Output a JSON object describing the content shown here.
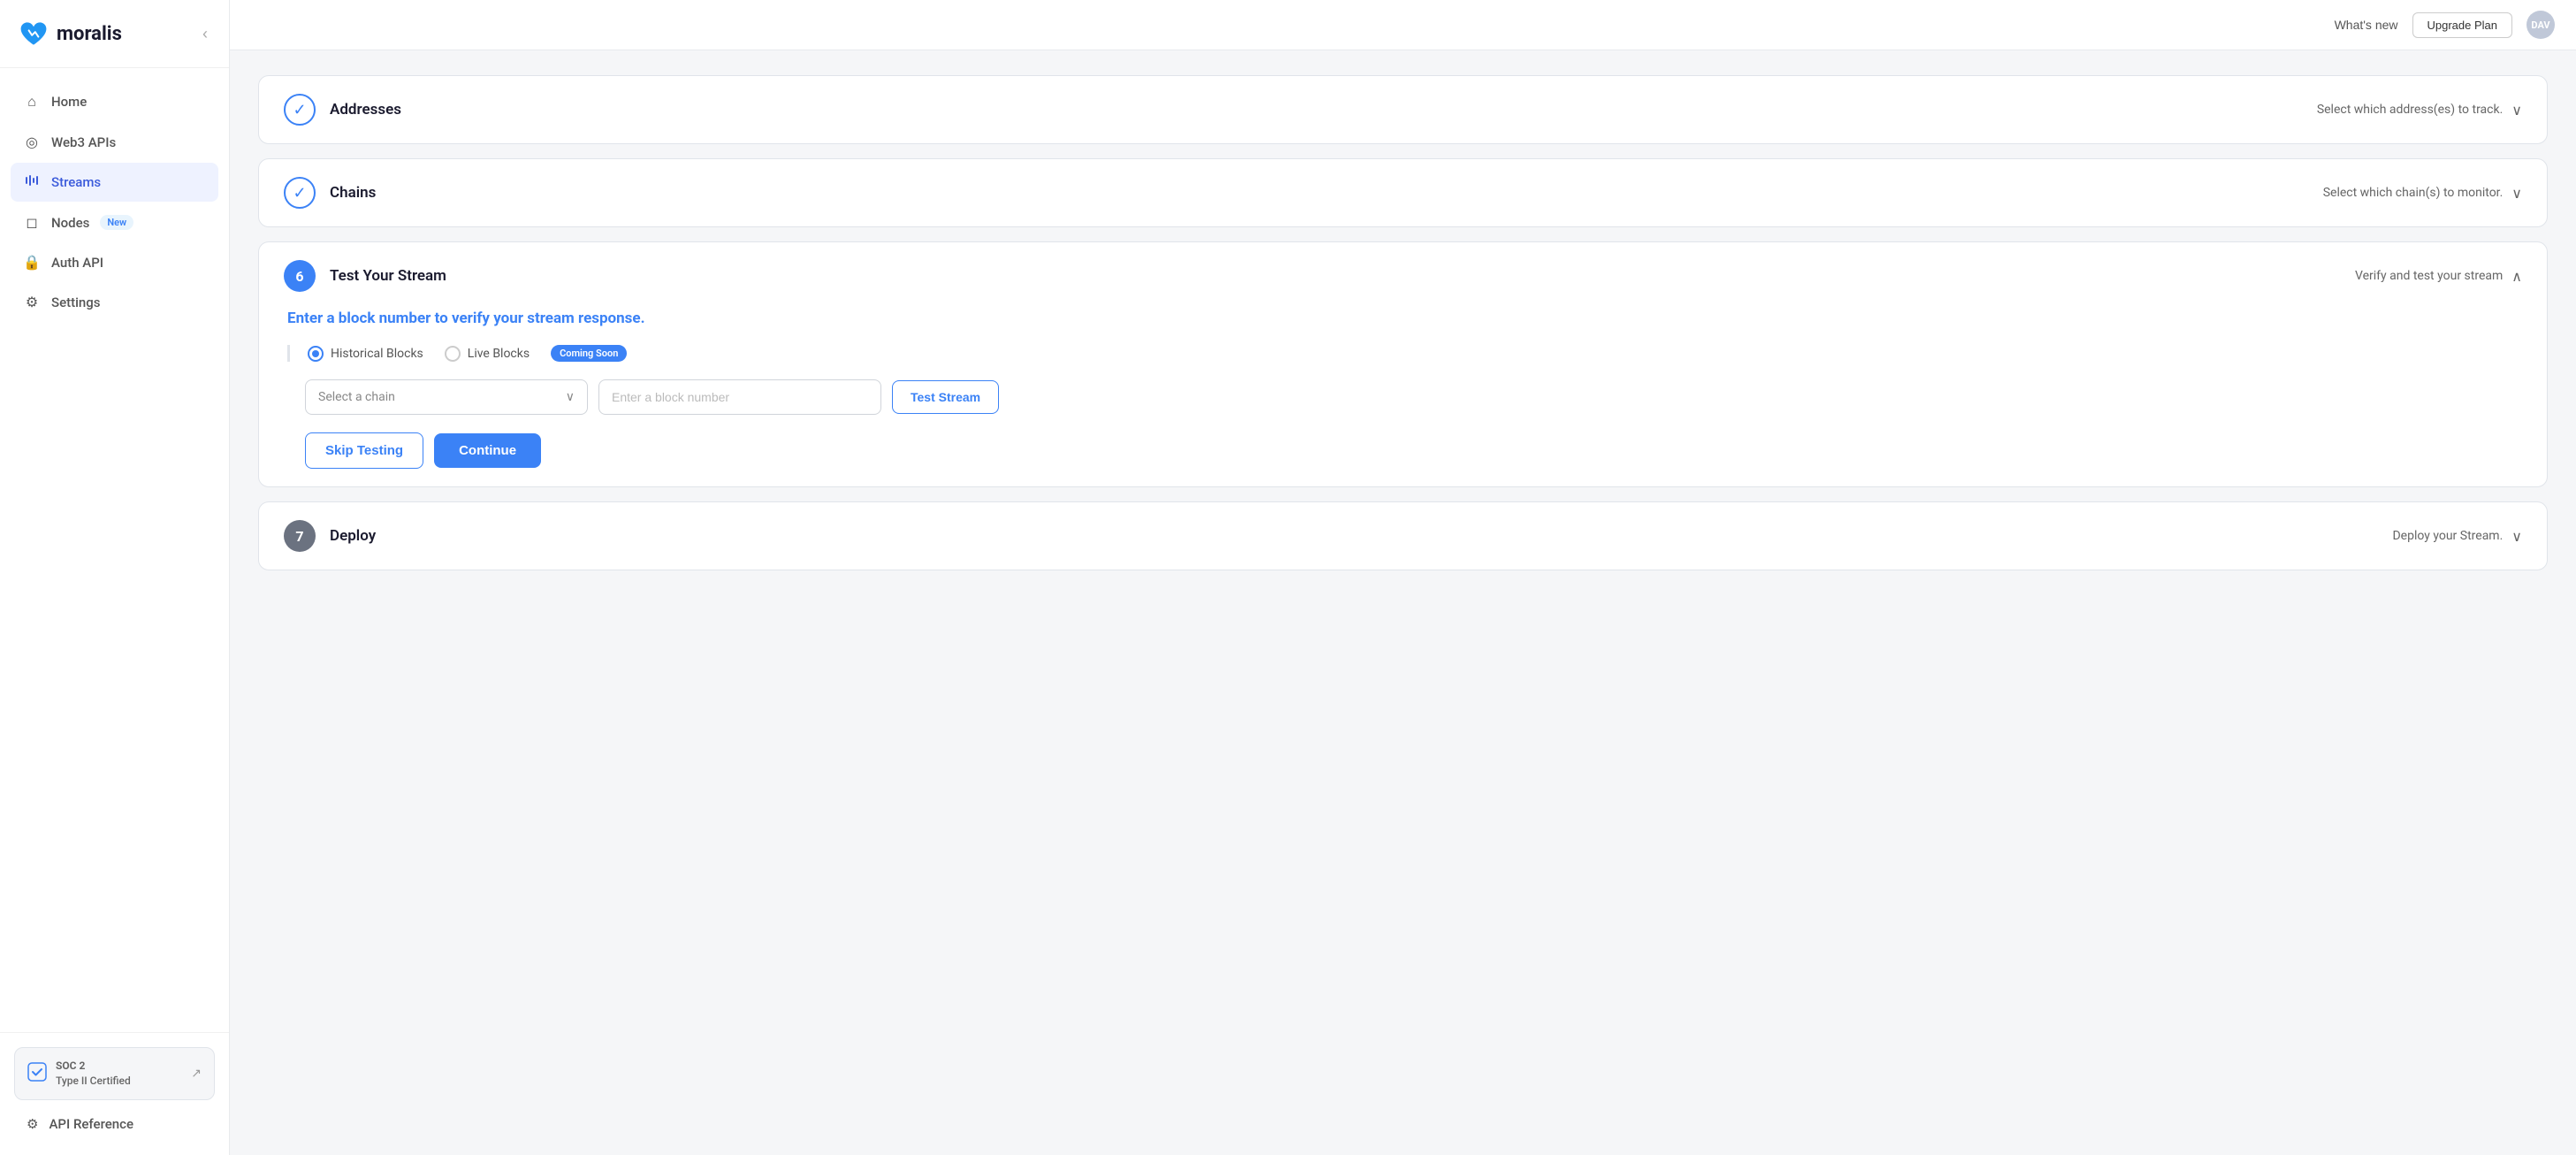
{
  "brand": {
    "name": "moralis"
  },
  "topbar": {
    "whats_new_label": "What's new",
    "upgrade_label": "Upgrade Plan",
    "avatar_initials": "DAV"
  },
  "sidebar": {
    "collapse_icon": "‹",
    "items": [
      {
        "id": "home",
        "label": "Home",
        "icon": "⌂",
        "active": false
      },
      {
        "id": "web3apis",
        "label": "Web3 APIs",
        "icon": "◎",
        "active": false
      },
      {
        "id": "streams",
        "label": "Streams",
        "icon": "▶",
        "active": true
      },
      {
        "id": "nodes",
        "label": "Nodes",
        "icon": "◻",
        "badge": "New",
        "active": false
      },
      {
        "id": "authapi",
        "label": "Auth API",
        "icon": "🔒",
        "active": false
      },
      {
        "id": "settings",
        "label": "Settings",
        "icon": "⚙",
        "active": false
      }
    ],
    "soc2": {
      "title": "SOC 2",
      "subtitle": "Type II Certified",
      "arrow": "↗"
    },
    "api_ref": {
      "label": "API Reference",
      "icon": "⚙"
    }
  },
  "sections": {
    "addresses": {
      "step_check": "✓",
      "title": "Addresses",
      "description": "Select which address(es) to track.",
      "chevron": "∨"
    },
    "chains": {
      "step_check": "✓",
      "title": "Chains",
      "description": "Select which chain(s) to monitor.",
      "chevron": "∨"
    },
    "test_stream": {
      "step_number": "6",
      "title": "Test Your Stream",
      "description": "Verify and test your stream",
      "chevron": "∧",
      "subtitle": "Enter a block number to verify your stream response.",
      "historical_blocks_label": "Historical Blocks",
      "live_blocks_label": "Live Blocks",
      "coming_soon_label": "Coming Soon",
      "select_chain_placeholder": "Select a chain",
      "block_number_placeholder": "Enter a block number",
      "test_stream_btn_label": "Test Stream",
      "skip_testing_label": "Skip Testing",
      "continue_label": "Continue"
    },
    "deploy": {
      "step_number": "7",
      "title": "Deploy",
      "description": "Deploy your Stream.",
      "chevron": "∨"
    }
  }
}
